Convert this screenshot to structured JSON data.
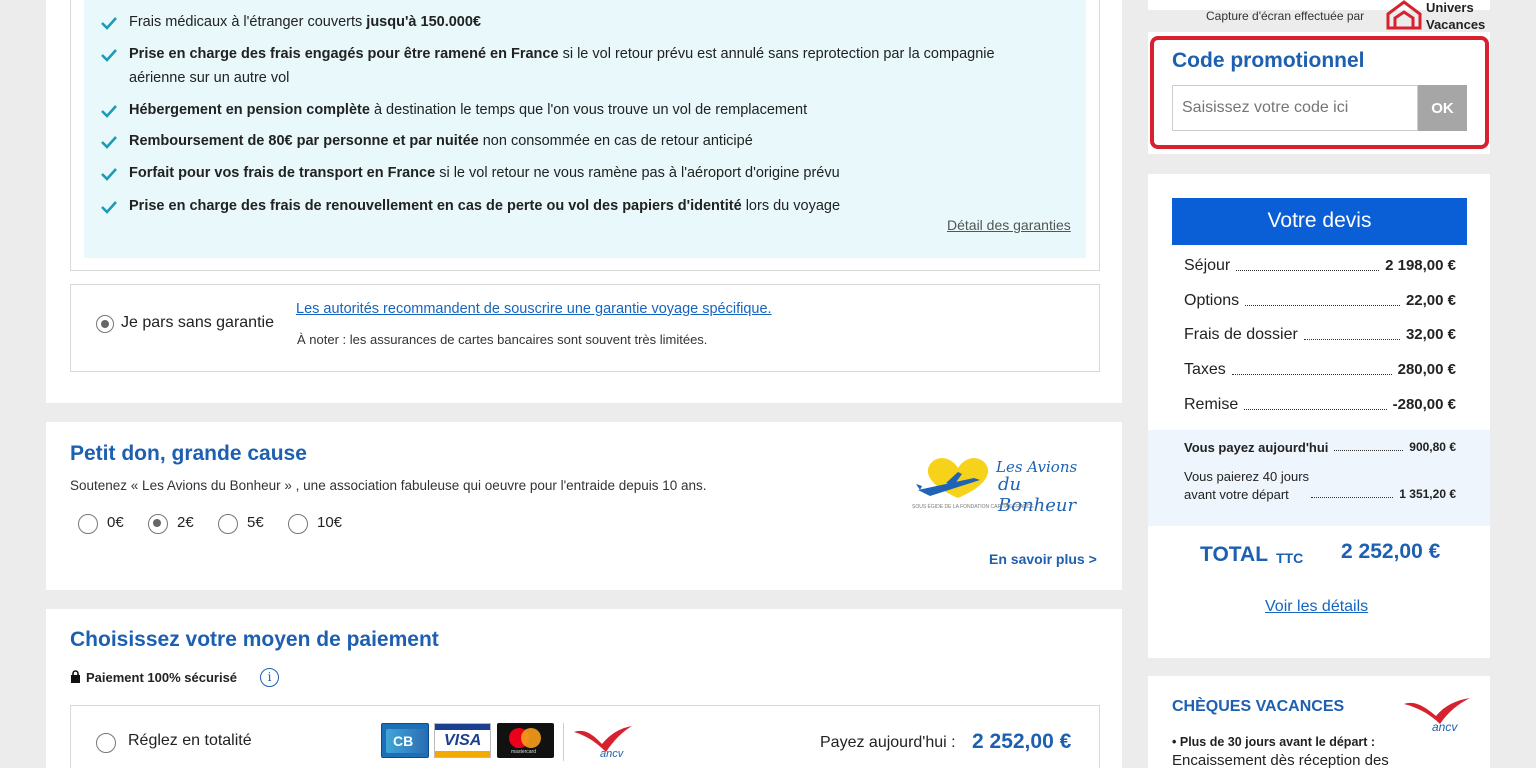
{
  "guarantees": {
    "items": [
      {
        "pre": "Frais médicaux à l'étranger couverts ",
        "bold": "jusqu'à 150.000€",
        "post": ""
      },
      {
        "pre": "",
        "bold": "Prise en charge des frais engagés pour être ramené en France",
        "post": " si le vol retour prévu est annulé sans reprotection par la compagnie"
      },
      {
        "pre": "aérienne sur un autre vol",
        "bold": "",
        "post": ""
      },
      {
        "pre": "",
        "bold": "Hébergement en pension complète",
        "post": " à destination le temps que l'on vous trouve un vol de remplacement"
      },
      {
        "pre": "",
        "bold": "Remboursement de 80€ par personne et par nuitée",
        "post": " non consommée en cas de retour anticipé"
      },
      {
        "pre": "",
        "bold": "Forfait pour vos frais de transport en France",
        "post": " si le vol retour ne vous ramène pas à l'aéroport d'origine prévu"
      },
      {
        "pre": "",
        "bold": "Prise en charge des frais de renouvellement en cas de perte ou vol des papiers d'identité",
        "post": " lors du voyage"
      }
    ],
    "details_link": "Détail des garanties"
  },
  "no_guarantee": {
    "label": "Je pars sans garantie",
    "recommend_link": "Les autorités recommandent de souscrire une garantie voyage spécifique.",
    "note": "À noter : les assurances de cartes bancaires sont souvent très limitées."
  },
  "donation": {
    "title": "Petit don, grande cause",
    "description": "Soutenez « Les Avions du Bonheur » , une association fabuleuse qui oeuvre pour l'entraide depuis 10 ans.",
    "options": [
      "0€",
      "2€",
      "5€",
      "10€"
    ],
    "selected": "2€",
    "more_link": "En savoir plus >",
    "logo": {
      "line1": "Les Avions",
      "line2": "du Bonheur",
      "sub": "SOUS ÉGIDE DE LA FONDATION CARITAS FRANCE"
    }
  },
  "payment": {
    "title": "Choisissez votre moyen de paiement",
    "secure_label": "Paiement 100% sécurisé",
    "option_label": "Réglez en totalité",
    "pay_today_label": "Payez aujourd'hui :",
    "pay_today_amount": "2 252,00 €",
    "cards": [
      "CB",
      "VISA",
      "mastercard",
      "ancv"
    ]
  },
  "capture": {
    "text": "Capture d'écran effectuée par",
    "brand_line1": "Univers",
    "brand_line2": "Vacances"
  },
  "promo": {
    "title": "Code promotionnel",
    "placeholder": "Saisissez votre code ici",
    "ok": "OK"
  },
  "devis": {
    "title": "Votre devis",
    "rows": [
      {
        "label": "Séjour",
        "value": "2 198,00 €"
      },
      {
        "label": "Options",
        "value": "22,00 €"
      },
      {
        "label": "Frais de dossier",
        "value": "32,00 €"
      },
      {
        "label": "Taxes",
        "value": "280,00 €"
      },
      {
        "label": "Remise",
        "value": "-280,00 €"
      }
    ],
    "pay_today_label": "Vous payez aujourd'hui",
    "pay_today_value": "900,80 €",
    "pay_later_line1": "Vous paierez 40 jours",
    "pay_later_line2": "avant votre départ",
    "pay_later_value": "1 351,20 €",
    "total_label": "TOTAL",
    "total_ttc": "TTC",
    "total_value": "2 252,00 €",
    "details_link": "Voir les détails"
  },
  "cheques": {
    "title": "CHÈQUES VACANCES",
    "bullet": "Plus de 30 jours avant le départ :",
    "text": "Encaissement dès réception des"
  },
  "colors": {
    "accent": "#1d5fb0",
    "devis_header": "#0a5fd6",
    "promo_border": "#d8212e",
    "ancv_red": "#d8212e"
  }
}
